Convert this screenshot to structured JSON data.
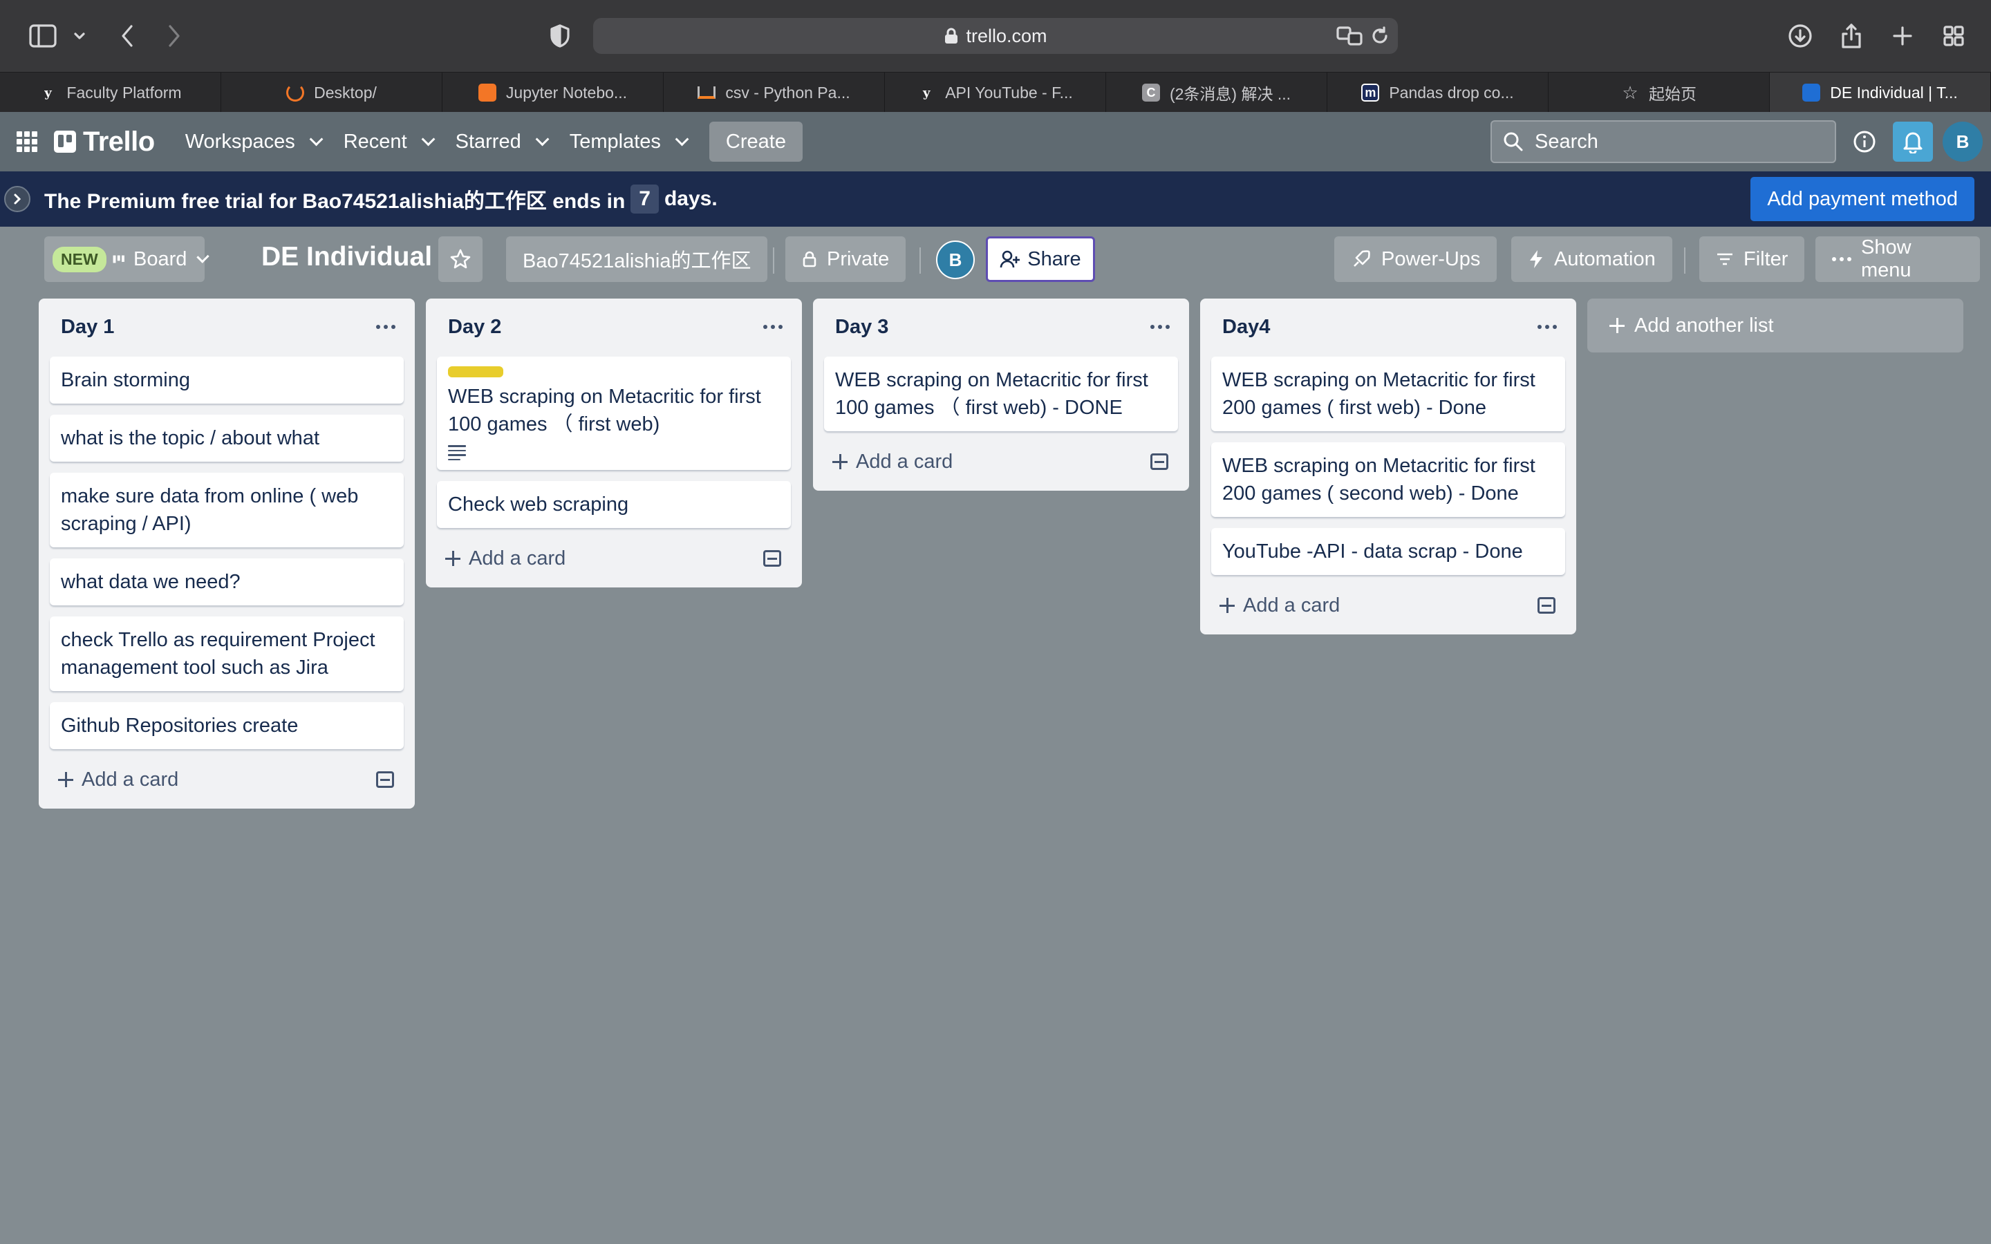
{
  "browser": {
    "url": "trello.com",
    "tabs": [
      {
        "label": "Faculty Platform",
        "icon": "y-icon"
      },
      {
        "label": "Desktop/",
        "icon": "jupyter-icon"
      },
      {
        "label": "Jupyter Notebo...",
        "icon": "book-icon"
      },
      {
        "label": "csv - Python Pa...",
        "icon": "stackoverflow-icon"
      },
      {
        "label": "API YouTube - F...",
        "icon": "y-icon"
      },
      {
        "label": "(2条消息) 解决 ...",
        "icon": "c-icon"
      },
      {
        "label": "Pandas drop co...",
        "icon": "m-icon"
      },
      {
        "label": "起始页",
        "icon": "star-icon"
      },
      {
        "label": "DE Individual | T...",
        "icon": "trello-icon"
      }
    ]
  },
  "header": {
    "logo": "Trello",
    "nav": {
      "workspaces": "Workspaces",
      "recent": "Recent",
      "starred": "Starred",
      "templates": "Templates"
    },
    "create": "Create",
    "search_placeholder": "Search",
    "avatar": "B"
  },
  "banner": {
    "text_before": "The Premium free trial for Bao74521alishia的工作区 ends in",
    "days": "7",
    "text_after": "days.",
    "payment_button": "Add payment method"
  },
  "board": {
    "new_badge": "NEW",
    "view": "Board",
    "title": "DE Individual",
    "workspace": "Bao74521alishia的工作区",
    "visibility": "Private",
    "member_avatar": "B",
    "share": "Share",
    "power_ups": "Power-Ups",
    "automation": "Automation",
    "filter": "Filter",
    "show_menu": "Show menu",
    "add_list": "Add another list"
  },
  "lists": [
    {
      "title": "Day 1",
      "cards": [
        "Brain storming",
        "what is the topic / about what",
        "make sure data from online ( web scraping / API)",
        "what data we need?",
        "check Trello as requirement Project management tool such as Jira",
        "Github Repositories create"
      ],
      "add_card": "Add a card"
    },
    {
      "title": "Day 2",
      "cards": [
        "WEB scraping on Metacritic for first 100 games （ first web)",
        "Check web scraping"
      ],
      "label_color": "#e8cd2c",
      "add_card": "Add a card"
    },
    {
      "title": "Day 3",
      "cards": [
        "WEB scraping on Metacritic for first 100 games （ first web) - DONE"
      ],
      "add_card": "Add a card"
    },
    {
      "title": "Day4",
      "cards": [
        "WEB scraping on Metacritic for first 200 games ( first web) - Done",
        "WEB scraping on Metacritic for first 200 games ( second web) - Done",
        "YouTube -API - data scrap - Done"
      ],
      "add_card": "Add a card"
    }
  ],
  "colors": {
    "banner": "#1c2b4d",
    "board_bg": "#838c91",
    "payment": "#1f6ed4",
    "share_border": "#5e4db2"
  }
}
